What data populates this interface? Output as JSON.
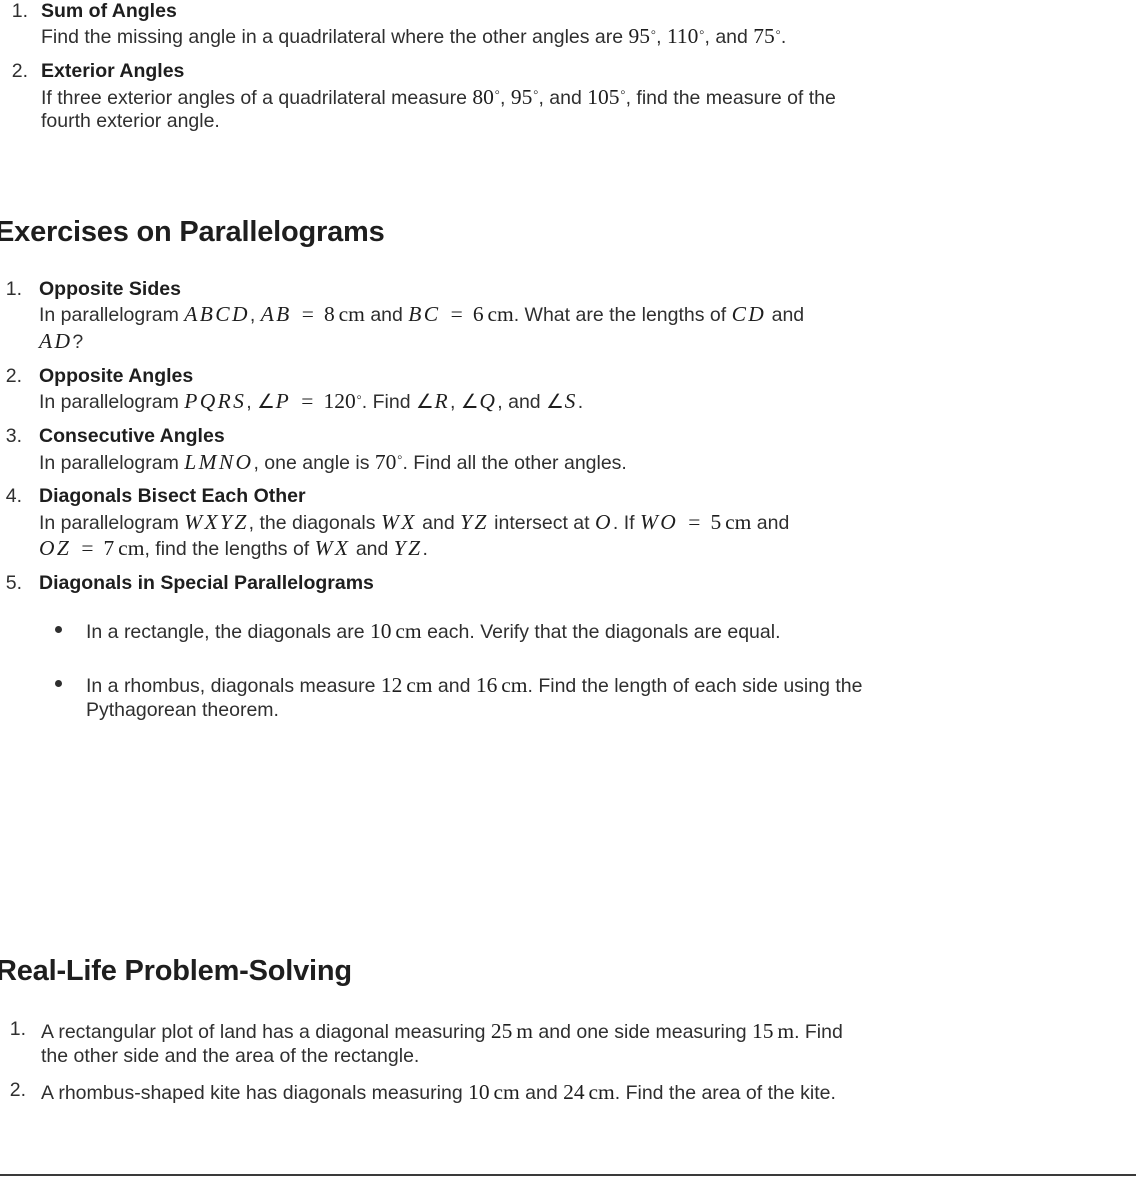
{
  "document": {
    "background": "#ffffff",
    "text_color": "#2f2f2f",
    "heading_color": "#1e1e1e"
  },
  "quadrilateral_exercises": {
    "items": [
      {
        "marker": "1.",
        "title": "Sum of Angles",
        "lines": [
          {
            "parts": [
              {
                "t": "text",
                "v": "Find the missing angle in a quadrilateral where the other angles are "
              },
              {
                "t": "math",
                "v": "95°"
              },
              {
                "t": "text",
                "v": ", "
              },
              {
                "t": "math",
                "v": "110°"
              },
              {
                "t": "text",
                "v": ", and "
              },
              {
                "t": "math",
                "v": "75°"
              },
              {
                "t": "text",
                "v": "."
              }
            ]
          }
        ]
      },
      {
        "marker": "2.",
        "title": "Exterior Angles",
        "lines": [
          {
            "parts": [
              {
                "t": "text",
                "v": "If three exterior angles of a quadrilateral measure "
              },
              {
                "t": "math",
                "v": "80°"
              },
              {
                "t": "text",
                "v": ", "
              },
              {
                "t": "math",
                "v": "95°"
              },
              {
                "t": "text",
                "v": ", and "
              },
              {
                "t": "math",
                "v": "105°"
              },
              {
                "t": "text",
                "v": ", find the measure of the"
              }
            ]
          },
          {
            "parts": [
              {
                "t": "text",
                "v": "fourth exterior angle."
              }
            ]
          }
        ]
      }
    ]
  },
  "parallelograms": {
    "heading": "Exercises on Parallelograms",
    "items": [
      {
        "marker": "1.",
        "title": "Opposite Sides",
        "lines": [
          {
            "parts": [
              {
                "t": "text",
                "v": "In parallelogram "
              },
              {
                "t": "math",
                "v": "ABCD"
              },
              {
                "t": "text",
                "v": ", "
              },
              {
                "t": "math",
                "v": "AB = 8 cm"
              },
              {
                "t": "text",
                "v": " and "
              },
              {
                "t": "math",
                "v": "BC = 6 cm"
              },
              {
                "t": "text",
                "v": ". What are the lengths of "
              },
              {
                "t": "math",
                "v": "CD"
              },
              {
                "t": "text",
                "v": " and"
              }
            ]
          },
          {
            "parts": [
              {
                "t": "math",
                "v": "AD"
              },
              {
                "t": "text",
                "v": "?"
              }
            ]
          }
        ]
      },
      {
        "marker": "2.",
        "title": "Opposite Angles",
        "lines": [
          {
            "parts": [
              {
                "t": "text",
                "v": "In parallelogram "
              },
              {
                "t": "math",
                "v": "PQRS"
              },
              {
                "t": "text",
                "v": ", "
              },
              {
                "t": "math",
                "v": "∠P = 120°"
              },
              {
                "t": "text",
                "v": ". Find "
              },
              {
                "t": "math",
                "v": "∠R"
              },
              {
                "t": "text",
                "v": ", "
              },
              {
                "t": "math",
                "v": "∠Q"
              },
              {
                "t": "text",
                "v": ", and "
              },
              {
                "t": "math",
                "v": "∠S"
              },
              {
                "t": "text",
                "v": "."
              }
            ]
          }
        ]
      },
      {
        "marker": "3.",
        "title": "Consecutive Angles",
        "lines": [
          {
            "parts": [
              {
                "t": "text",
                "v": "In parallelogram "
              },
              {
                "t": "math",
                "v": "LMNO"
              },
              {
                "t": "text",
                "v": ", one angle is "
              },
              {
                "t": "math",
                "v": "70°"
              },
              {
                "t": "text",
                "v": ". Find all the other angles."
              }
            ]
          }
        ]
      },
      {
        "marker": "4.",
        "title": "Diagonals Bisect Each Other",
        "lines": [
          {
            "parts": [
              {
                "t": "text",
                "v": "In parallelogram "
              },
              {
                "t": "math",
                "v": "WXYZ"
              },
              {
                "t": "text",
                "v": ", the diagonals "
              },
              {
                "t": "math",
                "v": "WX"
              },
              {
                "t": "text",
                "v": " and "
              },
              {
                "t": "math",
                "v": "YZ"
              },
              {
                "t": "text",
                "v": " intersect at "
              },
              {
                "t": "math",
                "v": "O"
              },
              {
                "t": "text",
                "v": ". If "
              },
              {
                "t": "math",
                "v": "WO = 5 cm"
              },
              {
                "t": "text",
                "v": " and"
              }
            ]
          },
          {
            "parts": [
              {
                "t": "math",
                "v": "OZ = 7 cm"
              },
              {
                "t": "text",
                "v": ", find the lengths of "
              },
              {
                "t": "math",
                "v": "WX"
              },
              {
                "t": "text",
                "v": " and "
              },
              {
                "t": "math",
                "v": "YZ"
              },
              {
                "t": "text",
                "v": "."
              }
            ]
          }
        ]
      },
      {
        "marker": "5.",
        "title": "Diagonals in Special Parallelograms",
        "bullets": [
          {
            "lines": [
              {
                "parts": [
                  {
                    "t": "text",
                    "v": "In a rectangle, the diagonals are "
                  },
                  {
                    "t": "math",
                    "v": "10 cm"
                  },
                  {
                    "t": "text",
                    "v": " each. Verify that the diagonals are equal."
                  }
                ]
              }
            ]
          },
          {
            "lines": [
              {
                "parts": [
                  {
                    "t": "text",
                    "v": "In a rhombus, diagonals measure "
                  },
                  {
                    "t": "math",
                    "v": "12 cm"
                  },
                  {
                    "t": "text",
                    "v": " and "
                  },
                  {
                    "t": "math",
                    "v": "16 cm"
                  },
                  {
                    "t": "text",
                    "v": ". Find the length of each side using the"
                  }
                ]
              },
              {
                "parts": [
                  {
                    "t": "text",
                    "v": "Pythagorean theorem."
                  }
                ]
              }
            ]
          }
        ]
      }
    ]
  },
  "real_life": {
    "heading": "Real-Life Problem-Solving",
    "items": [
      {
        "marker": "1.",
        "lines": [
          {
            "parts": [
              {
                "t": "text",
                "v": "A rectangular plot of land has a diagonal measuring "
              },
              {
                "t": "math",
                "v": "25 m"
              },
              {
                "t": "text",
                "v": " and one side measuring "
              },
              {
                "t": "math",
                "v": "15 m"
              },
              {
                "t": "text",
                "v": ". Find"
              }
            ]
          },
          {
            "parts": [
              {
                "t": "text",
                "v": "the other side and the area of the rectangle."
              }
            ]
          }
        ]
      },
      {
        "marker": "2.",
        "lines": [
          {
            "parts": [
              {
                "t": "text",
                "v": "A rhombus-shaped kite has diagonals measuring "
              },
              {
                "t": "math",
                "v": "10 cm"
              },
              {
                "t": "text",
                "v": " and "
              },
              {
                "t": "math",
                "v": "24 cm"
              },
              {
                "t": "text",
                "v": ". Find the area of the kite."
              }
            ]
          }
        ]
      }
    ]
  }
}
